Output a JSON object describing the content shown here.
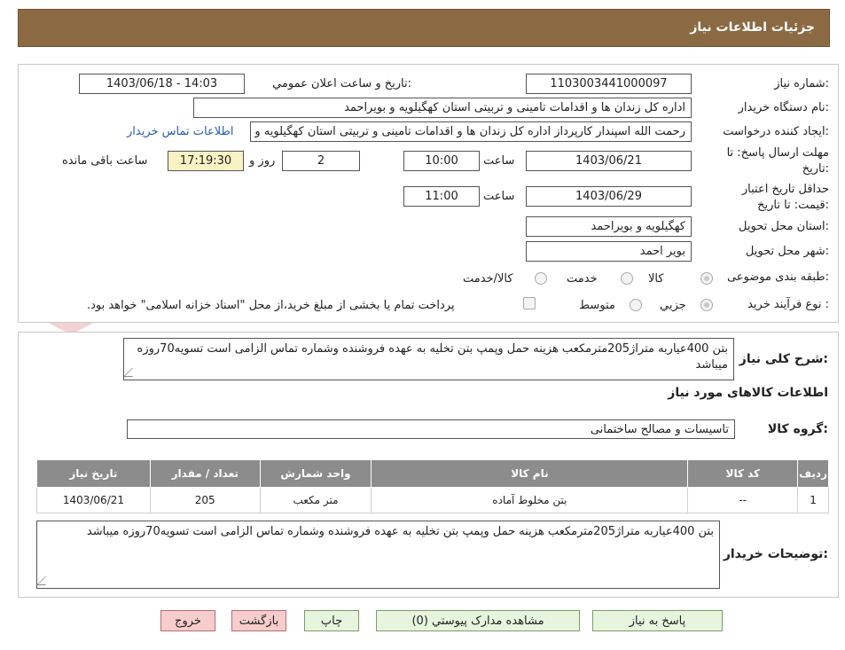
{
  "header": {
    "title": "جزئیات اطلاعات نیاز"
  },
  "form": {
    "need_number_label": "شماره نیاز:",
    "need_number": "1103003441000097",
    "announce_label": "تاریخ و ساعت اعلان عمومي:",
    "announce_value": "1403/06/18 - 14:03",
    "buyer_org_label": "نام دستگاه خريدار:",
    "buyer_org": "اداره کل زندان ها و اقدامات تامینی و تربیتی استان کهگیلویه و بویراحمد",
    "requester_label": "ايجاد کننده درخواست:",
    "requester": "رحمت الله اسپندار کارپرداز اداره کل زندان ها و اقدامات تامینی و تربیتی استان کهگیلویه و بویراحمد",
    "buyer_contact_link": "اطلاعات تماس خريدار",
    "reply_deadline_label_1": "مهلت ارسال پاسخ: تا",
    "reply_deadline_label_2": "تاریخ:",
    "reply_date": "1403/06/21",
    "time_label": "ساعت",
    "reply_time": "10:00",
    "days_value": "2",
    "days_label": "روز و",
    "remaining_time": "17:19:30",
    "remaining_label": "ساعت باقی مانده",
    "validity_label_1": "حداقل تاريخ اعتبار",
    "validity_label_2": "قيمت: تا تاريخ:",
    "validity_date": "1403/06/29",
    "validity_time": "11:00",
    "province_label": "استان محل تحويل:",
    "province": "کهگیلویه و بویراحمد",
    "city_label": "شهر محل تحويل:",
    "city": "بویر احمد",
    "category_label": "طبقه بندی موضوعی:",
    "category_options": [
      "کالا",
      "خدمت",
      "کالا/خدمت"
    ],
    "process_label": "نوع فرآیند خرید :",
    "process_options": [
      "جزیي",
      "متوسط"
    ],
    "payment_note": "پرداخت تمام یا بخشی از مبلغ خرید،از محل \"اسناد خزانه اسلامی\" خواهد بود."
  },
  "summary": {
    "label": "شرح کلی نیاز:",
    "text": "بتن 400عیاربه متراژ205مترمکعب هزینه حمل وپمپ بتن تخلیه به عهده فروشنده وشماره تماس الزامی است تسویه70روزه میباشد"
  },
  "goods": {
    "section_title": "اطلاعات کالاهای مورد نیاز",
    "group_label": "گروه کالا:",
    "group_value": "تاسیسات و مصالح ساختمانی",
    "columns": [
      "رديف",
      "کد کالا",
      "نام کالا",
      "واحد شمارش",
      "تعداد / مقدار",
      "تاريخ نياز"
    ],
    "rows": [
      [
        "1",
        "--",
        "بتن مخلوط آماده",
        "متر مکعب",
        "205",
        "1403/06/21"
      ]
    ]
  },
  "buyer_notes": {
    "label": "توضیحات خریدار:",
    "text": "بتن 400عیاربه متراژ205مترمکعب هزینه حمل وپمپ بتن تخلیه به عهده فروشنده وشماره تماس الزامی است تسویه70روزه میباشد"
  },
  "buttons": {
    "reply": "پاسخ به نياز",
    "attachments": "مشاهده مدارک پيوستي (0)",
    "print": "چاپ",
    "back": "بازگشت",
    "exit": "خروج"
  },
  "watermark": {
    "text": "AriaTender.neT"
  },
  "colors": {
    "header": "#8b6a43",
    "table_header": "#8c8c8c",
    "button": "#e7f5df",
    "button_red": "#f7cccc",
    "link": "#2a5db0"
  }
}
